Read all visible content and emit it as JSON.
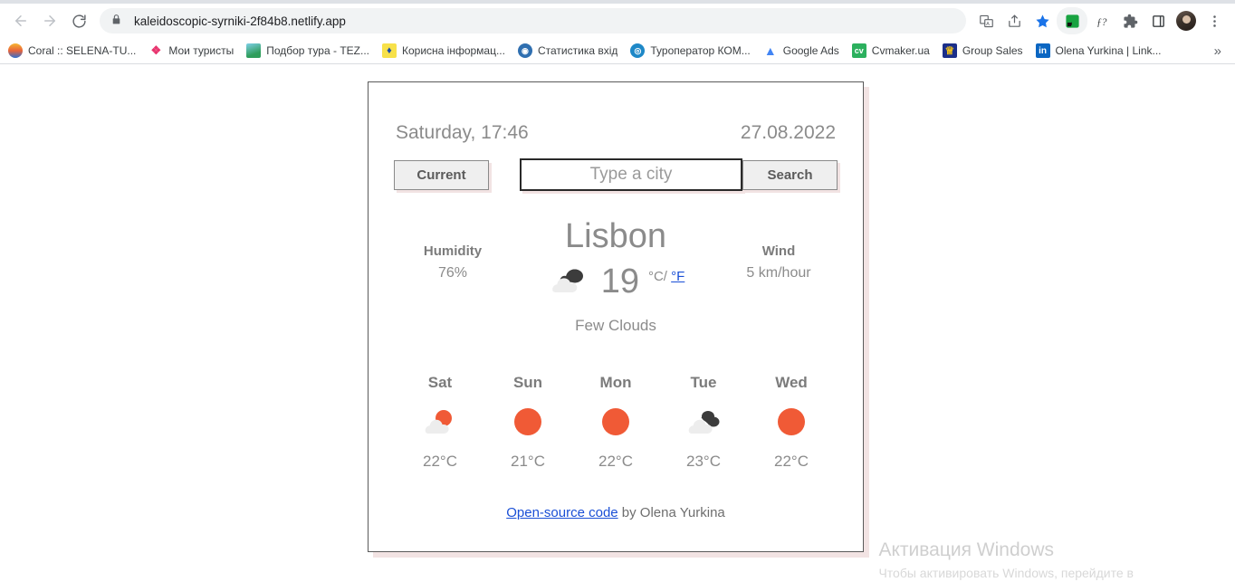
{
  "browser": {
    "back_tooltip": "Back",
    "forward_tooltip": "Forward",
    "reload_tooltip": "Reload",
    "url": "kaleidoscopic-syrniki-2f84b8.netlify.app",
    "toolbar_icons": [
      {
        "name": "translate-icon",
        "glyph": "文"
      },
      {
        "name": "share-icon",
        "glyph": "↱"
      },
      {
        "name": "bookmark-star-icon",
        "glyph": "★"
      },
      {
        "name": "extension-green-icon",
        "glyph": "◥"
      },
      {
        "name": "font-extension-icon",
        "glyph": "ƒ?"
      },
      {
        "name": "extensions-puzzle-icon",
        "glyph": "⚙"
      },
      {
        "name": "side-panel-icon",
        "glyph": "□"
      },
      {
        "name": "profile-avatar",
        "glyph": ""
      },
      {
        "name": "chrome-menu-icon",
        "glyph": "⋮"
      }
    ],
    "bookmarks": [
      {
        "label": "Coral :: SELENA-TU...",
        "icon": "coral-icon",
        "color": "#f0a63c",
        "short": ""
      },
      {
        "label": "Мои туристы",
        "icon": "moi-turisty-icon",
        "color": "#e8336d",
        "short": ""
      },
      {
        "label": "Подбор тура - TEZ...",
        "icon": "tez-tour-icon",
        "color": "#3fa9c9",
        "short": ""
      },
      {
        "label": "Корисна інформац...",
        "icon": "ukraine-trident-icon",
        "color": "#f5d020",
        "short": ""
      },
      {
        "label": "Статистика вхід",
        "icon": "statistics-icon",
        "color": "#2f6fb0",
        "short": ""
      },
      {
        "label": "Туроператор КОМ...",
        "icon": "tour-operator-icon",
        "color": "#1e88c7",
        "short": ""
      },
      {
        "label": "Google Ads",
        "icon": "google-ads-icon",
        "color": "#ffffff",
        "short": ""
      },
      {
        "label": "Cvmaker.ua",
        "icon": "cvmaker-icon",
        "color": "#2cb05e",
        "short": "cv"
      },
      {
        "label": "Group Sales",
        "icon": "group-sales-icon",
        "color": "#1b2f8a",
        "short": ""
      },
      {
        "label": "Olena Yurkina | Link...",
        "icon": "linkedin-icon",
        "color": "#0a66c2",
        "short": "in"
      }
    ],
    "bookmark_overflow": "»"
  },
  "app": {
    "datetime": "Saturday, 17:46",
    "date": "27.08.2022",
    "current_button": "Current",
    "search_button": "Search",
    "city_placeholder": "Type a city",
    "city_value": "",
    "city_name": "Lisbon",
    "temperature": "19",
    "unit_celsius": "°C/",
    "unit_fahrenheit": "°F",
    "description": "Few Clouds",
    "main_icon": "cloud-with-dark-cloud-icon",
    "humidity": {
      "label": "Humidity",
      "value": "76%"
    },
    "wind": {
      "label": "Wind",
      "value": "5 km/hour"
    },
    "forecast": [
      {
        "day": "Sat",
        "temp": "22°C",
        "icon": "sun-behind-cloud-icon"
      },
      {
        "day": "Sun",
        "temp": "21°C",
        "icon": "sun-icon"
      },
      {
        "day": "Mon",
        "temp": "22°C",
        "icon": "sun-icon"
      },
      {
        "day": "Tue",
        "temp": "23°C",
        "icon": "dark-cloud-behind-cloud-icon"
      },
      {
        "day": "Wed",
        "temp": "22°C",
        "icon": "sun-icon"
      }
    ],
    "footer_link": "Open-source code",
    "footer_text": " by Olena Yurkina"
  },
  "windows_watermark": {
    "title": "Активация Windows",
    "subtitle": "Чтобы активировать Windows, перейдите в"
  },
  "colors": {
    "sun": "#f05a36",
    "cloud_light": "#ededed",
    "cloud_dark": "#3c3c3c",
    "link": "#1a4fd6",
    "card_shadow": "#f2e3e3",
    "text_gray": "#8b8b8b"
  }
}
